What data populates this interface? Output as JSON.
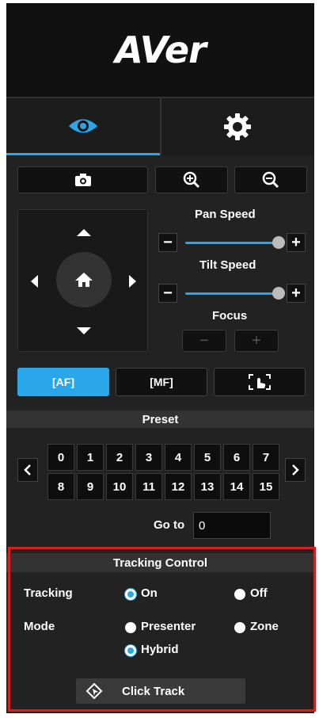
{
  "brand": {
    "logo_text": "AVer"
  },
  "tabs": [
    {
      "name": "live-view",
      "icon": "eye-icon",
      "active": true
    },
    {
      "name": "settings",
      "icon": "gear-icon",
      "active": false
    }
  ],
  "toolbar": {
    "snapshot_icon": "camera-icon",
    "zoom_in_icon": "zoom-in-icon",
    "zoom_out_icon": "zoom-out-icon"
  },
  "ptz": {
    "pan_speed_label": "Pan Speed",
    "tilt_speed_label": "Tilt Speed",
    "focus_label": "Focus",
    "minus": "−",
    "plus": "+",
    "pan_speed_value": 0.95,
    "tilt_speed_value": 0.95
  },
  "focus_modes": [
    {
      "label": "[AF]",
      "active": true
    },
    {
      "label": "[MF]",
      "active": false
    },
    {
      "label": "touch",
      "icon": "touch-focus-icon",
      "active": false
    }
  ],
  "preset": {
    "title": "Preset",
    "buttons": [
      "0",
      "1",
      "2",
      "3",
      "4",
      "5",
      "6",
      "7",
      "8",
      "9",
      "10",
      "11",
      "12",
      "13",
      "14",
      "15"
    ],
    "goto_label": "Go to",
    "goto_value": "0"
  },
  "tracking": {
    "title": "Tracking Control",
    "tracking_label": "Tracking",
    "on_label": "On",
    "off_label": "Off",
    "tracking_selected": "On",
    "mode_label": "Mode",
    "presenter_label": "Presenter",
    "zone_label": "Zone",
    "hybrid_label": "Hybrid",
    "mode_selected": "Hybrid",
    "click_track_label": "Click Track"
  },
  "colors": {
    "accent": "#2aa7ea",
    "highlight_border": "#d42020"
  }
}
